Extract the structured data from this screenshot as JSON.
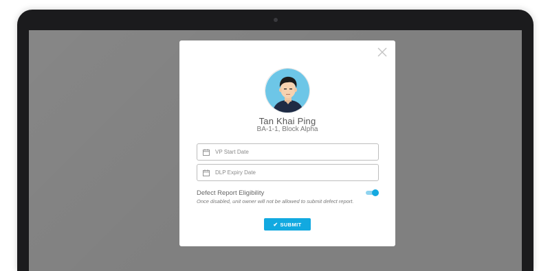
{
  "modal": {
    "user_name": "Tan Khai Ping",
    "unit_address": "BA-1-1, Block Alpha",
    "fields": [
      {
        "placeholder": "VP Start Date",
        "value": ""
      },
      {
        "placeholder": "DLP Expiry Date",
        "value": ""
      }
    ],
    "eligibility": {
      "label": "Defect Report Eligibility",
      "description": "Once disabled, unit owner will not be allowed to submit defect report.",
      "enabled": true
    },
    "submit_label": "SUBMIT",
    "icons": {
      "close": "close-icon",
      "calendar": "calendar-icon",
      "check": "check-icon"
    },
    "colors": {
      "accent": "#12a9e0",
      "overlay": "#808080",
      "avatar_bg": "#6dc6e7"
    }
  }
}
